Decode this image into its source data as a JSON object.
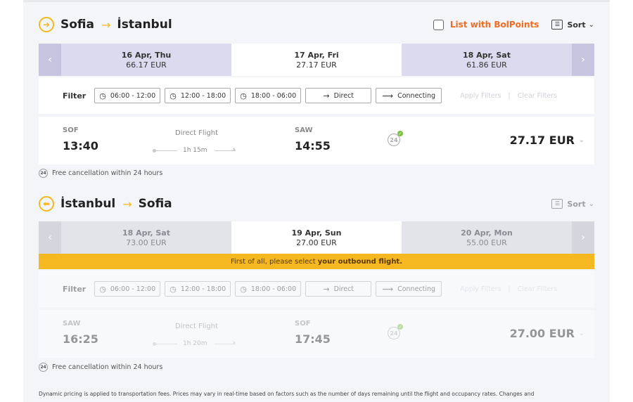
{
  "outbound": {
    "from": "Sofia",
    "to": "İstanbul",
    "list_with_bolpoints": "List with BolPoints",
    "sort_label": "Sort",
    "dates": [
      {
        "date": "16 Apr, Thu",
        "price": "66.17 EUR"
      },
      {
        "date": "17 Apr, Fri",
        "price": "27.17 EUR"
      },
      {
        "date": "18 Apr, Sat",
        "price": "61.86 EUR"
      }
    ],
    "filter": {
      "label": "Filter",
      "time1": "06:00 - 12:00",
      "time2": "12:00 - 18:00",
      "time3": "18:00 - 06:00",
      "direct": "Direct",
      "connecting": "Connecting",
      "apply": "Apply Filters",
      "clear": "Clear Filters"
    },
    "flight": {
      "dep_code": "SOF",
      "dep_time": "13:40",
      "type": "Direct Flight",
      "duration": "1h 15m",
      "arr_code": "SAW",
      "arr_time": "14:55",
      "badge": "24",
      "price": "27.17 EUR"
    },
    "free_cancel": "Free cancellation within 24 hours"
  },
  "return": {
    "from": "İstanbul",
    "to": "Sofia",
    "sort_label": "Sort",
    "dates": [
      {
        "date": "18 Apr, Sat",
        "price": "73.00 EUR"
      },
      {
        "date": "19 Apr, Sun",
        "price": "27.00 EUR"
      },
      {
        "date": "20 Apr, Mon",
        "price": "55.00 EUR"
      }
    ],
    "notice_prefix": "First of all, please select",
    "notice_bold": "your outbound flight.",
    "filter": {
      "label": "Filter",
      "time1": "06:00 - 12:00",
      "time2": "12:00 - 18:00",
      "time3": "18:00 - 06:00",
      "direct": "Direct",
      "connecting": "Connecting",
      "apply": "Apply Filters",
      "clear": "Clear Filters"
    },
    "flight": {
      "dep_code": "SAW",
      "dep_time": "16:25",
      "type": "Direct Flight",
      "duration": "1h 20m",
      "arr_code": "SOF",
      "arr_time": "17:45",
      "badge": "24",
      "price": "27.00 EUR"
    },
    "free_cancel": "Free cancellation within 24 hours"
  },
  "footnote": "Dynamic pricing is applied to transportation fees. Prices may vary in real-time based on factors such as the number of days remaining until the flight and occupancy rates. Changes and",
  "colors": {
    "accent": "#f5b820",
    "bolpoints": "#f26b21",
    "date_bg": "#dcdaee"
  }
}
